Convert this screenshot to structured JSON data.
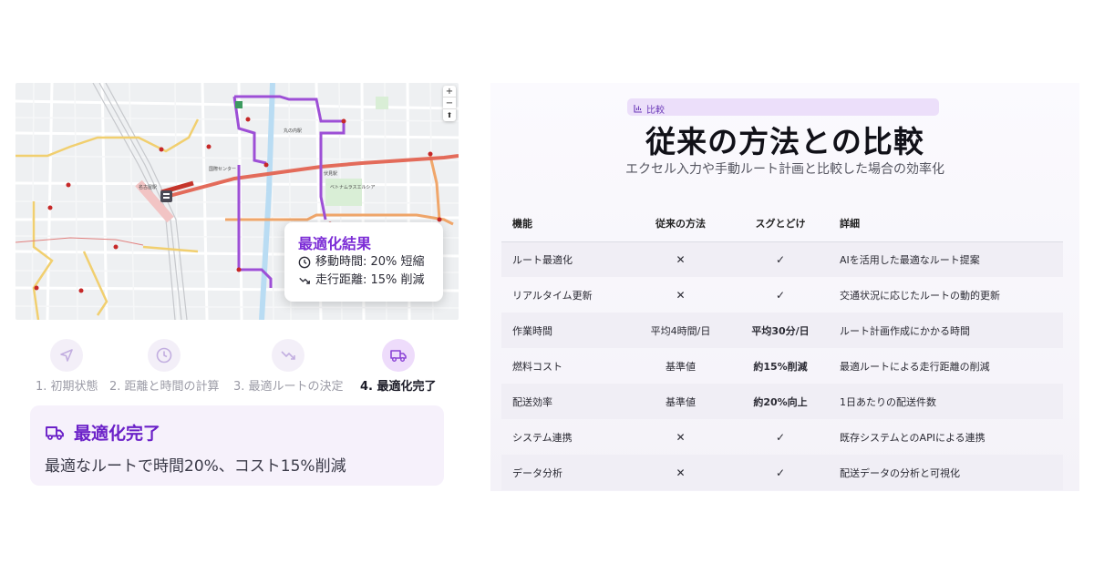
{
  "map": {
    "zoom_in": "+",
    "zoom_out": "−",
    "compass": "⬆",
    "labels": {
      "station1": "丸の内駅",
      "station2": "名古屋駅",
      "station3": "国際センター",
      "station4": "伏見駅",
      "station5": "ベトナムラスエルシア"
    },
    "result_card": {
      "title": "最適化結果",
      "time_text": "移動時間: 20% 短縮",
      "distance_text": "走行距離: 15% 削減"
    }
  },
  "steps": [
    {
      "label": "1. 初期状態",
      "icon": "navigation-arrow-icon"
    },
    {
      "label": "2. 距離と時間の計算",
      "icon": "clock-icon"
    },
    {
      "label": "3. 最適ルートの決定",
      "icon": "trending-down-icon"
    },
    {
      "label": "4. 最適化完了",
      "icon": "truck-icon"
    }
  ],
  "completion": {
    "title": "最適化完了",
    "description": "最適なルートで時間20%、コスト15%削減"
  },
  "comparison": {
    "badge": "比較",
    "title": "従来の方法との比較",
    "subtitle": "エクセル入力や手動ルート計画と比較した場合の効率化",
    "headers": [
      "機能",
      "従来の方法",
      "スグとどけ",
      "詳細"
    ],
    "rows": [
      {
        "feature": "ルート最適化",
        "traditional": "✕",
        "sugu": "✓",
        "detail": "AIを活用した最適なルート提案"
      },
      {
        "feature": "リアルタイム更新",
        "traditional": "✕",
        "sugu": "✓",
        "detail": "交通状況に応じたルートの動的更新"
      },
      {
        "feature": "作業時間",
        "traditional": "平均4時間/日",
        "sugu": "平均30分/日",
        "detail": "ルート計画作成にかかる時間"
      },
      {
        "feature": "燃料コスト",
        "traditional": "基準値",
        "sugu": "約15%削減",
        "detail": "最適ルートによる走行距離の削減"
      },
      {
        "feature": "配送効率",
        "traditional": "基準値",
        "sugu": "約20%向上",
        "detail": "1日あたりの配送件数"
      },
      {
        "feature": "システム連携",
        "traditional": "✕",
        "sugu": "✓",
        "detail": "既存システムとのAPIによる連携"
      },
      {
        "feature": "データ分析",
        "traditional": "✕",
        "sugu": "✓",
        "detail": "配送データの分析と可視化"
      }
    ]
  },
  "colors": {
    "accent": "#7c2dd6",
    "cross": "#e0443e",
    "check": "#8b44d6"
  }
}
